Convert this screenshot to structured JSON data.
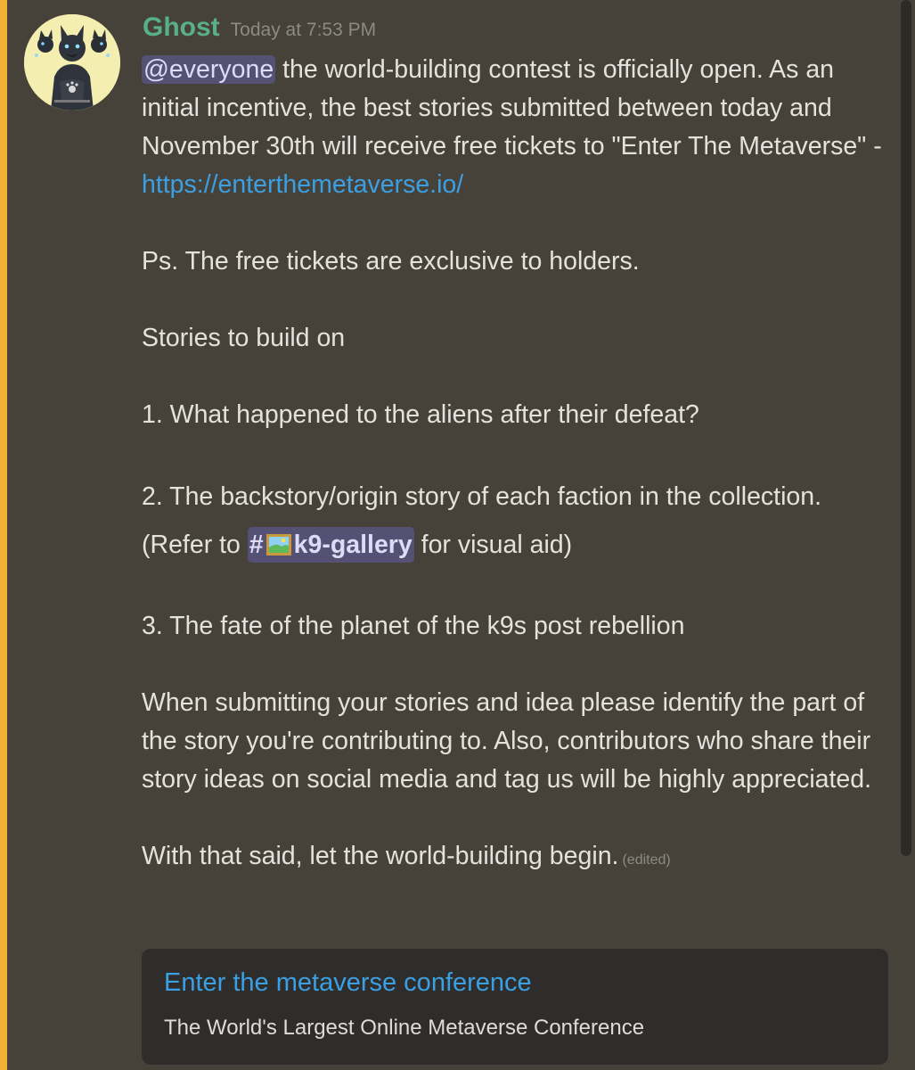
{
  "message": {
    "author": "Ghost",
    "timestamp": "Today at 7:53 PM",
    "mention": "@everyone",
    "intro_text": " the world-building contest is officially open. As an initial incentive, the best stories submitted between today and November 30th will receive free tickets to \"Enter The Metaverse\" - ",
    "link": "https://enterthemetaverse.io/",
    "ps": "Ps. The free tickets are exclusive to holders.",
    "stories_heading": "Stories to build on",
    "item1": "1. What happened to the aliens after their defeat?",
    "item2_before": "2. The backstory/origin story of each faction in the collection. (Refer to ",
    "channel_hash": "#",
    "channel_icon": "framed-picture-icon",
    "channel_name": "k9-gallery",
    "item2_after": " for visual aid)",
    "item3": "3. The fate of the planet of the k9s post rebellion",
    "instructions": "When submitting your stories and idea please identify the part of the story you're contributing to. Also, contributors who share their story ideas on social media and tag us will be highly appreciated.",
    "closing": "With that said, let the world-building begin.",
    "edited": "(edited)"
  },
  "embed": {
    "title": "Enter the metaverse conference",
    "description": "The World's Largest Online Metaverse Conference"
  },
  "colors": {
    "background": "#46423a",
    "mention_highlight": "#f0b232",
    "username": "#58b08a",
    "link": "#3aa0e3",
    "mention_bg": "#545175",
    "embed_bg": "#2e2d2b"
  }
}
